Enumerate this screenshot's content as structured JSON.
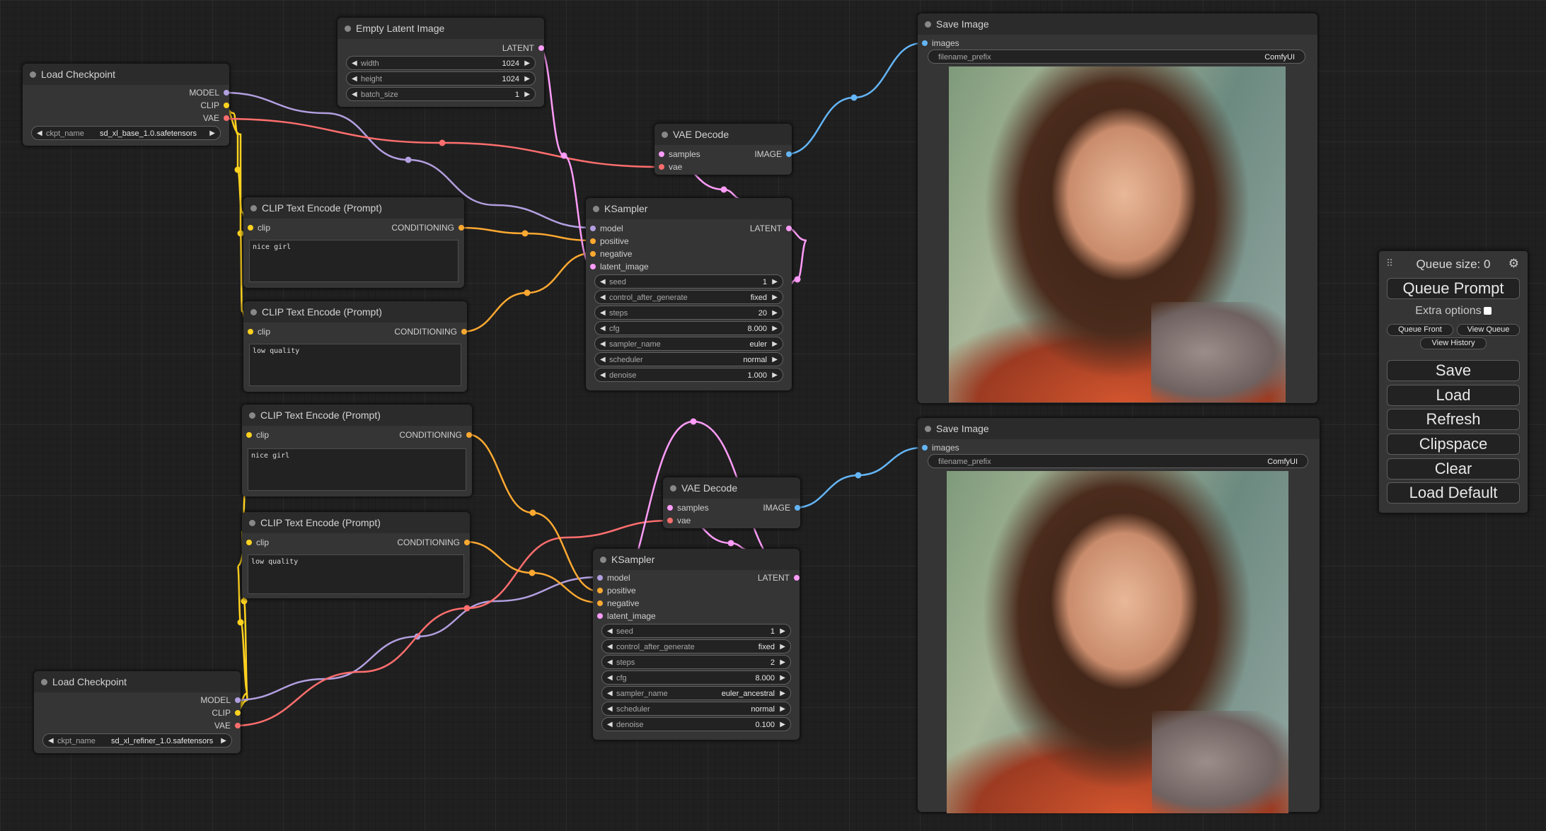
{
  "colors": {
    "model": "#b29fe0",
    "clip": "#ffd21f",
    "vae": "#ff6e6e",
    "latent": "#ff9cf9",
    "conditioning": "#ffa931",
    "image": "#64b5f6"
  },
  "load_checkpoint_1": {
    "title": "Load Checkpoint",
    "out_model": "MODEL",
    "out_clip": "CLIP",
    "out_vae": "VAE",
    "ckpt_label": "ckpt_name",
    "ckpt_value": "sd_xl_base_1.0.safetensors"
  },
  "load_checkpoint_2": {
    "title": "Load Checkpoint",
    "out_model": "MODEL",
    "out_clip": "CLIP",
    "out_vae": "VAE",
    "ckpt_label": "ckpt_name",
    "ckpt_value": "sd_xl_refiner_1.0.safetensors"
  },
  "empty_latent": {
    "title": "Empty Latent Image",
    "out_latent": "LATENT",
    "width_label": "width",
    "width_value": "1024",
    "height_label": "height",
    "height_value": "1024",
    "batch_label": "batch_size",
    "batch_value": "1"
  },
  "clip_1": {
    "title": "CLIP Text Encode (Prompt)",
    "in_clip": "clip",
    "out": "CONDITIONING",
    "text": "nice girl"
  },
  "clip_2": {
    "title": "CLIP Text Encode (Prompt)",
    "in_clip": "clip",
    "out": "CONDITIONING",
    "text": "low quality"
  },
  "clip_3": {
    "title": "CLIP Text Encode (Prompt)",
    "in_clip": "clip",
    "out": "CONDITIONING",
    "text": "nice girl"
  },
  "clip_4": {
    "title": "CLIP Text Encode (Prompt)",
    "in_clip": "clip",
    "out": "CONDITIONING",
    "text": "low quality"
  },
  "vae_decode_1": {
    "title": "VAE Decode",
    "in_samples": "samples",
    "in_vae": "vae",
    "out_image": "IMAGE"
  },
  "vae_decode_2": {
    "title": "VAE Decode",
    "in_samples": "samples",
    "in_vae": "vae",
    "out_image": "IMAGE"
  },
  "ksampler_1": {
    "title": "KSampler",
    "in_model": "model",
    "in_positive": "positive",
    "in_negative": "negative",
    "in_latent": "latent_image",
    "out_latent": "LATENT",
    "widgets": [
      {
        "label": "seed",
        "value": "1"
      },
      {
        "label": "control_after_generate",
        "value": "fixed"
      },
      {
        "label": "steps",
        "value": "20"
      },
      {
        "label": "cfg",
        "value": "8.000"
      },
      {
        "label": "sampler_name",
        "value": "euler"
      },
      {
        "label": "scheduler",
        "value": "normal"
      },
      {
        "label": "denoise",
        "value": "1.000"
      }
    ]
  },
  "ksampler_2": {
    "title": "KSampler",
    "in_model": "model",
    "in_positive": "positive",
    "in_negative": "negative",
    "in_latent": "latent_image",
    "out_latent": "LATENT",
    "widgets": [
      {
        "label": "seed",
        "value": "1"
      },
      {
        "label": "control_after_generate",
        "value": "fixed"
      },
      {
        "label": "steps",
        "value": "2"
      },
      {
        "label": "cfg",
        "value": "8.000"
      },
      {
        "label": "sampler_name",
        "value": "euler_ancestral"
      },
      {
        "label": "scheduler",
        "value": "normal"
      },
      {
        "label": "denoise",
        "value": "0.100"
      }
    ]
  },
  "save_image_1": {
    "title": "Save Image",
    "in_images": "images",
    "prefix_label": "filename_prefix",
    "prefix_value": "ComfyUI"
  },
  "save_image_2": {
    "title": "Save Image",
    "in_images": "images",
    "prefix_label": "filename_prefix",
    "prefix_value": "ComfyUI"
  },
  "menu": {
    "queue_size": "Queue size: 0",
    "queue_prompt": "Queue Prompt",
    "extra_options": "Extra options",
    "queue_front": "Queue Front",
    "view_queue": "View Queue",
    "view_history": "View History",
    "save": "Save",
    "load": "Load",
    "refresh": "Refresh",
    "clipspace": "Clipspace",
    "clear": "Clear",
    "load_default": "Load Default"
  }
}
